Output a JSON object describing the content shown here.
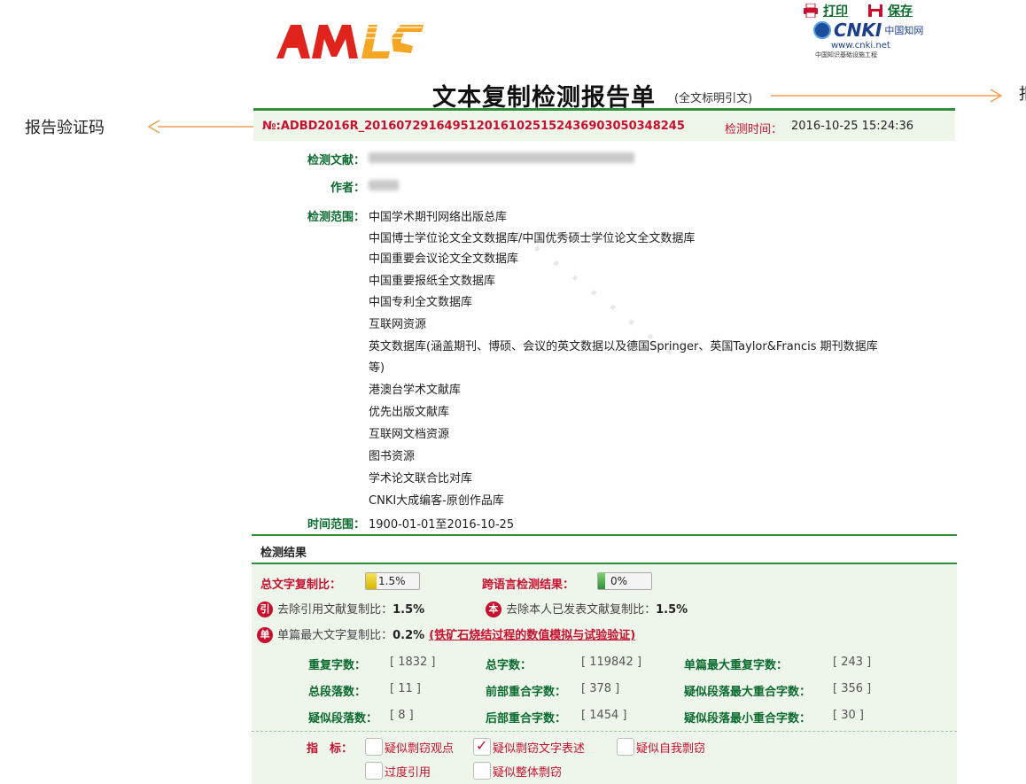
{
  "toolbar": {
    "print_label": "打印",
    "save_label": "保存"
  },
  "logos": {
    "cnki_text": "CNKI",
    "cnki_cn": "中国知网",
    "cnki_url": "www.cnki.net",
    "cnki_project": "中国知识基础设施工程"
  },
  "report": {
    "title": "文本复制检测报告单",
    "subtitle": "(全文标明引文)",
    "id_no": "№:ADBD2016R_2016072916495120161025152436903050348245",
    "time_label": "检测时间：",
    "time_value": "2016-10-25 15:24:36",
    "doc_label": "检测文献：",
    "author_label": "作者：",
    "scope_label": "检测范围：",
    "scope_items": [
      "中国学术期刊网络出版总库",
      "中国博士学位论文全文数据库/中国优秀硕士学位论文全文数据库",
      "中国重要会议论文全文数据库",
      "中国重要报纸全文数据库",
      "中国专利全文数据库",
      "互联网资源",
      "英文数据库(涵盖期刊、博硕、会议的英文数据以及德国Springer、英国Taylor&Francis 期刊数据库",
      "等)",
      "港澳台学术文献库",
      "优先出版文献库",
      "互联网文档资源",
      "图书资源",
      "学术论文联合比对库",
      "CNKI大成编客-原创作品库"
    ],
    "range_label": "时间范围：",
    "range_value": "1900-01-01至2016-10-25"
  },
  "annotations": {
    "left": "报告验证码",
    "right": "报"
  },
  "results": {
    "title": "检测结果",
    "total_ratio_label": "总文字复制比：",
    "total_ratio": "1.5%",
    "total_ratio_value": 0.015,
    "cross_lang_label": "跨语言检测结果：",
    "cross_lang": "0%",
    "cross_lang_value": 0,
    "excl_ref_label": "去除引用文献复制比：",
    "excl_ref_value": "1.5%",
    "excl_self_label": "去除本人已发表文献复制比：",
    "excl_self_value": "1.5%",
    "max_single_label": "单篇最大文字复制比：",
    "max_single_value": "0.2%",
    "max_single_title": "(铁矿石烧结过程的数值模拟与试验验证)",
    "stats": [
      {
        "label": "重复字数：",
        "value": "[ 1832 ]"
      },
      {
        "label": "总字数：",
        "value": "[ 119842 ]"
      },
      {
        "label": "单篇最大重复字数：",
        "value": "[ 243 ]"
      },
      {
        "label": "总段落数：",
        "value": "[ 11 ]"
      },
      {
        "label": "前部重合字数：",
        "value": "[ 378 ]"
      },
      {
        "label": "疑似段落最大重合字数：",
        "value": "[ 356 ]"
      },
      {
        "label": "疑似段落数：",
        "value": "[ 8 ]"
      },
      {
        "label": "后部重合字数：",
        "value": "[ 1454 ]"
      },
      {
        "label": "疑似段落最小重合字数：",
        "value": "[ 30 ]"
      }
    ],
    "indicator_label": "指　标：",
    "indicators": [
      {
        "label": "疑似剽窃观点",
        "checked": false
      },
      {
        "label": "疑似剽窃文字表述",
        "checked": true
      },
      {
        "label": "疑似自我剽窃",
        "checked": false
      },
      {
        "label": "过度引用",
        "checked": false
      },
      {
        "label": "疑似整体剽窃",
        "checked": false
      }
    ]
  },
  "colors": {
    "accent_green": "#2f8f3c",
    "label_green": "#0b6a2e",
    "alert_red": "#c8102e",
    "arrow_orange": "#f0a050"
  },
  "icons": {
    "print": "printer-icon",
    "save": "save-icon"
  }
}
